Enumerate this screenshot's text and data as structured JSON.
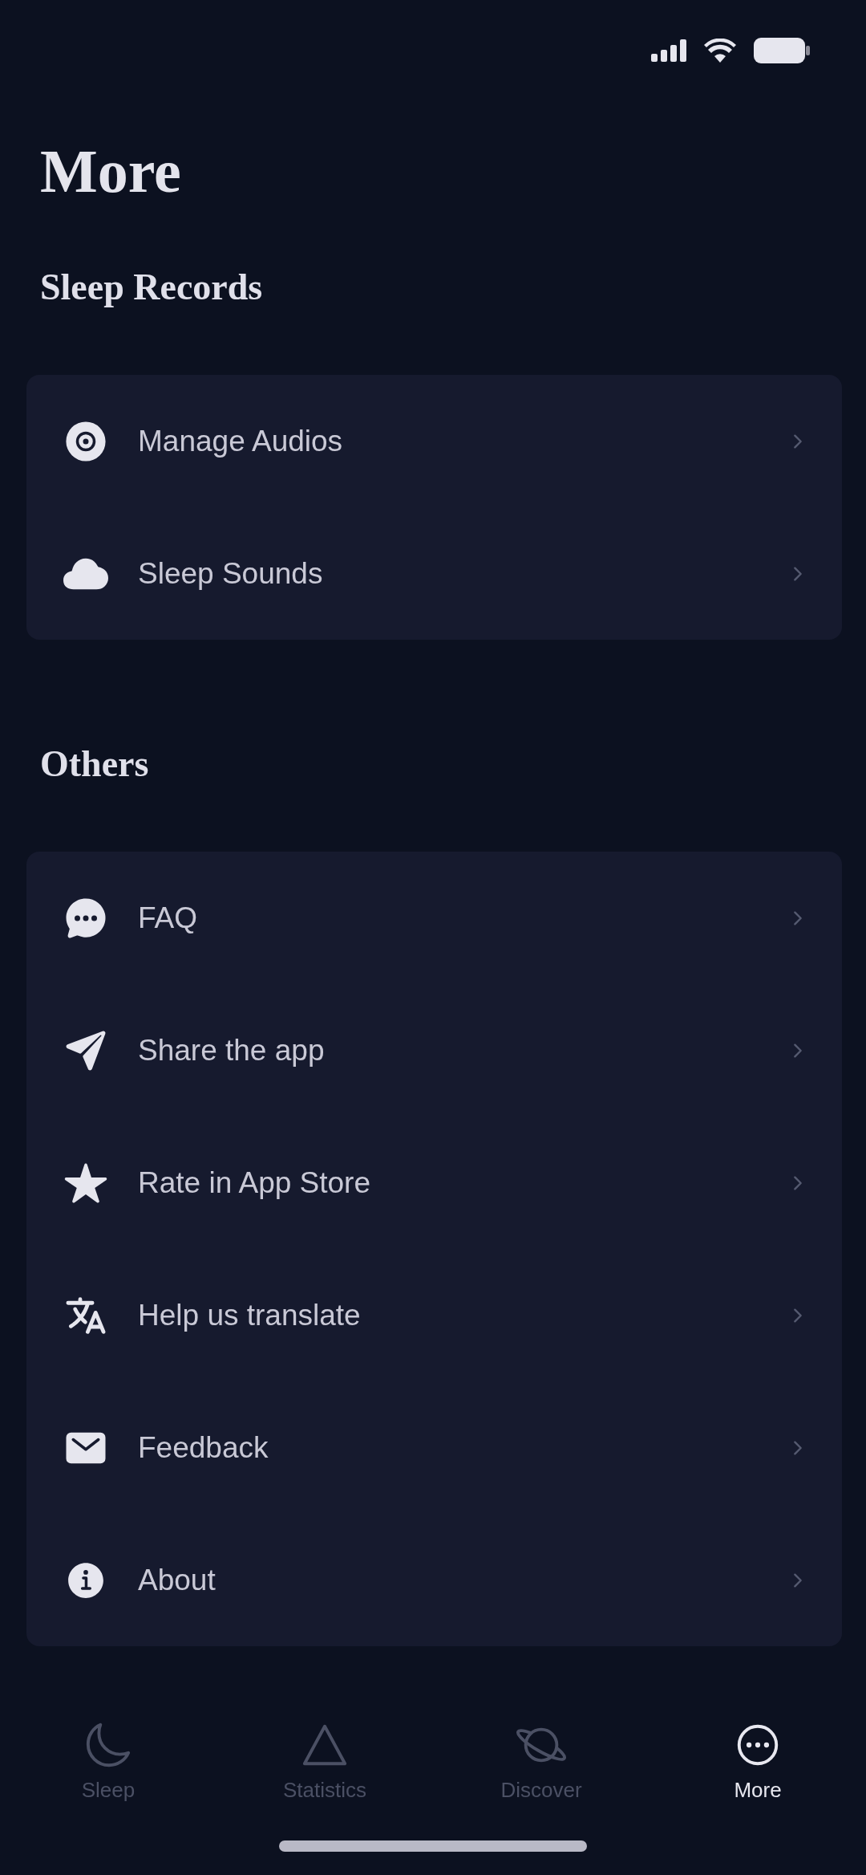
{
  "title": "More",
  "sections": [
    {
      "heading": "Sleep Records",
      "items": [
        {
          "label": "Manage Audios"
        },
        {
          "label": "Sleep Sounds"
        }
      ]
    },
    {
      "heading": "Others",
      "items": [
        {
          "label": "FAQ"
        },
        {
          "label": "Share the app"
        },
        {
          "label": "Rate in App Store"
        },
        {
          "label": "Help us translate"
        },
        {
          "label": "Feedback"
        },
        {
          "label": "About"
        }
      ]
    }
  ],
  "tab_bar": [
    {
      "label": "Sleep",
      "selected": false
    },
    {
      "label": "Statistics",
      "selected": false
    },
    {
      "label": "Discover",
      "selected": false
    },
    {
      "label": "More",
      "selected": true
    }
  ]
}
